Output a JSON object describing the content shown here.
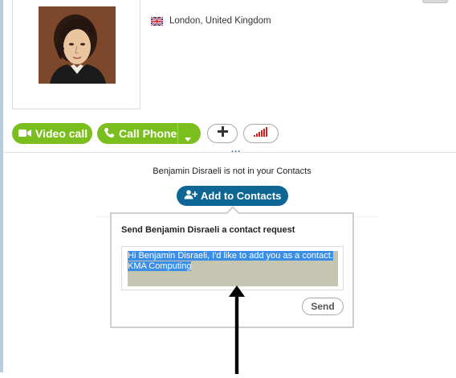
{
  "profile": {
    "location": "London, United Kingdom",
    "flag_icon": "uk-flag-icon",
    "avatar_icon": "profile-portrait"
  },
  "actions": {
    "video_call_label": "Video call",
    "call_phone_label": "Call Phone",
    "add_icon": "plus-icon",
    "signal_icon": "call-quality-icon",
    "more_label": "..."
  },
  "contact": {
    "status_text": "Benjamin Disraeli is not in your Contacts",
    "add_button_label": "Add to Contacts"
  },
  "request": {
    "title": "Send Benjamin Disraeli a contact request",
    "message_line1": "Hi Benjamin Disraeli, I'd like to add you as a contact.",
    "message_line2": "KMA Computing",
    "send_label": "Send"
  },
  "colors": {
    "green": "#7bbf1e",
    "blue": "#0e6694",
    "selection": "#3a8ee6"
  }
}
